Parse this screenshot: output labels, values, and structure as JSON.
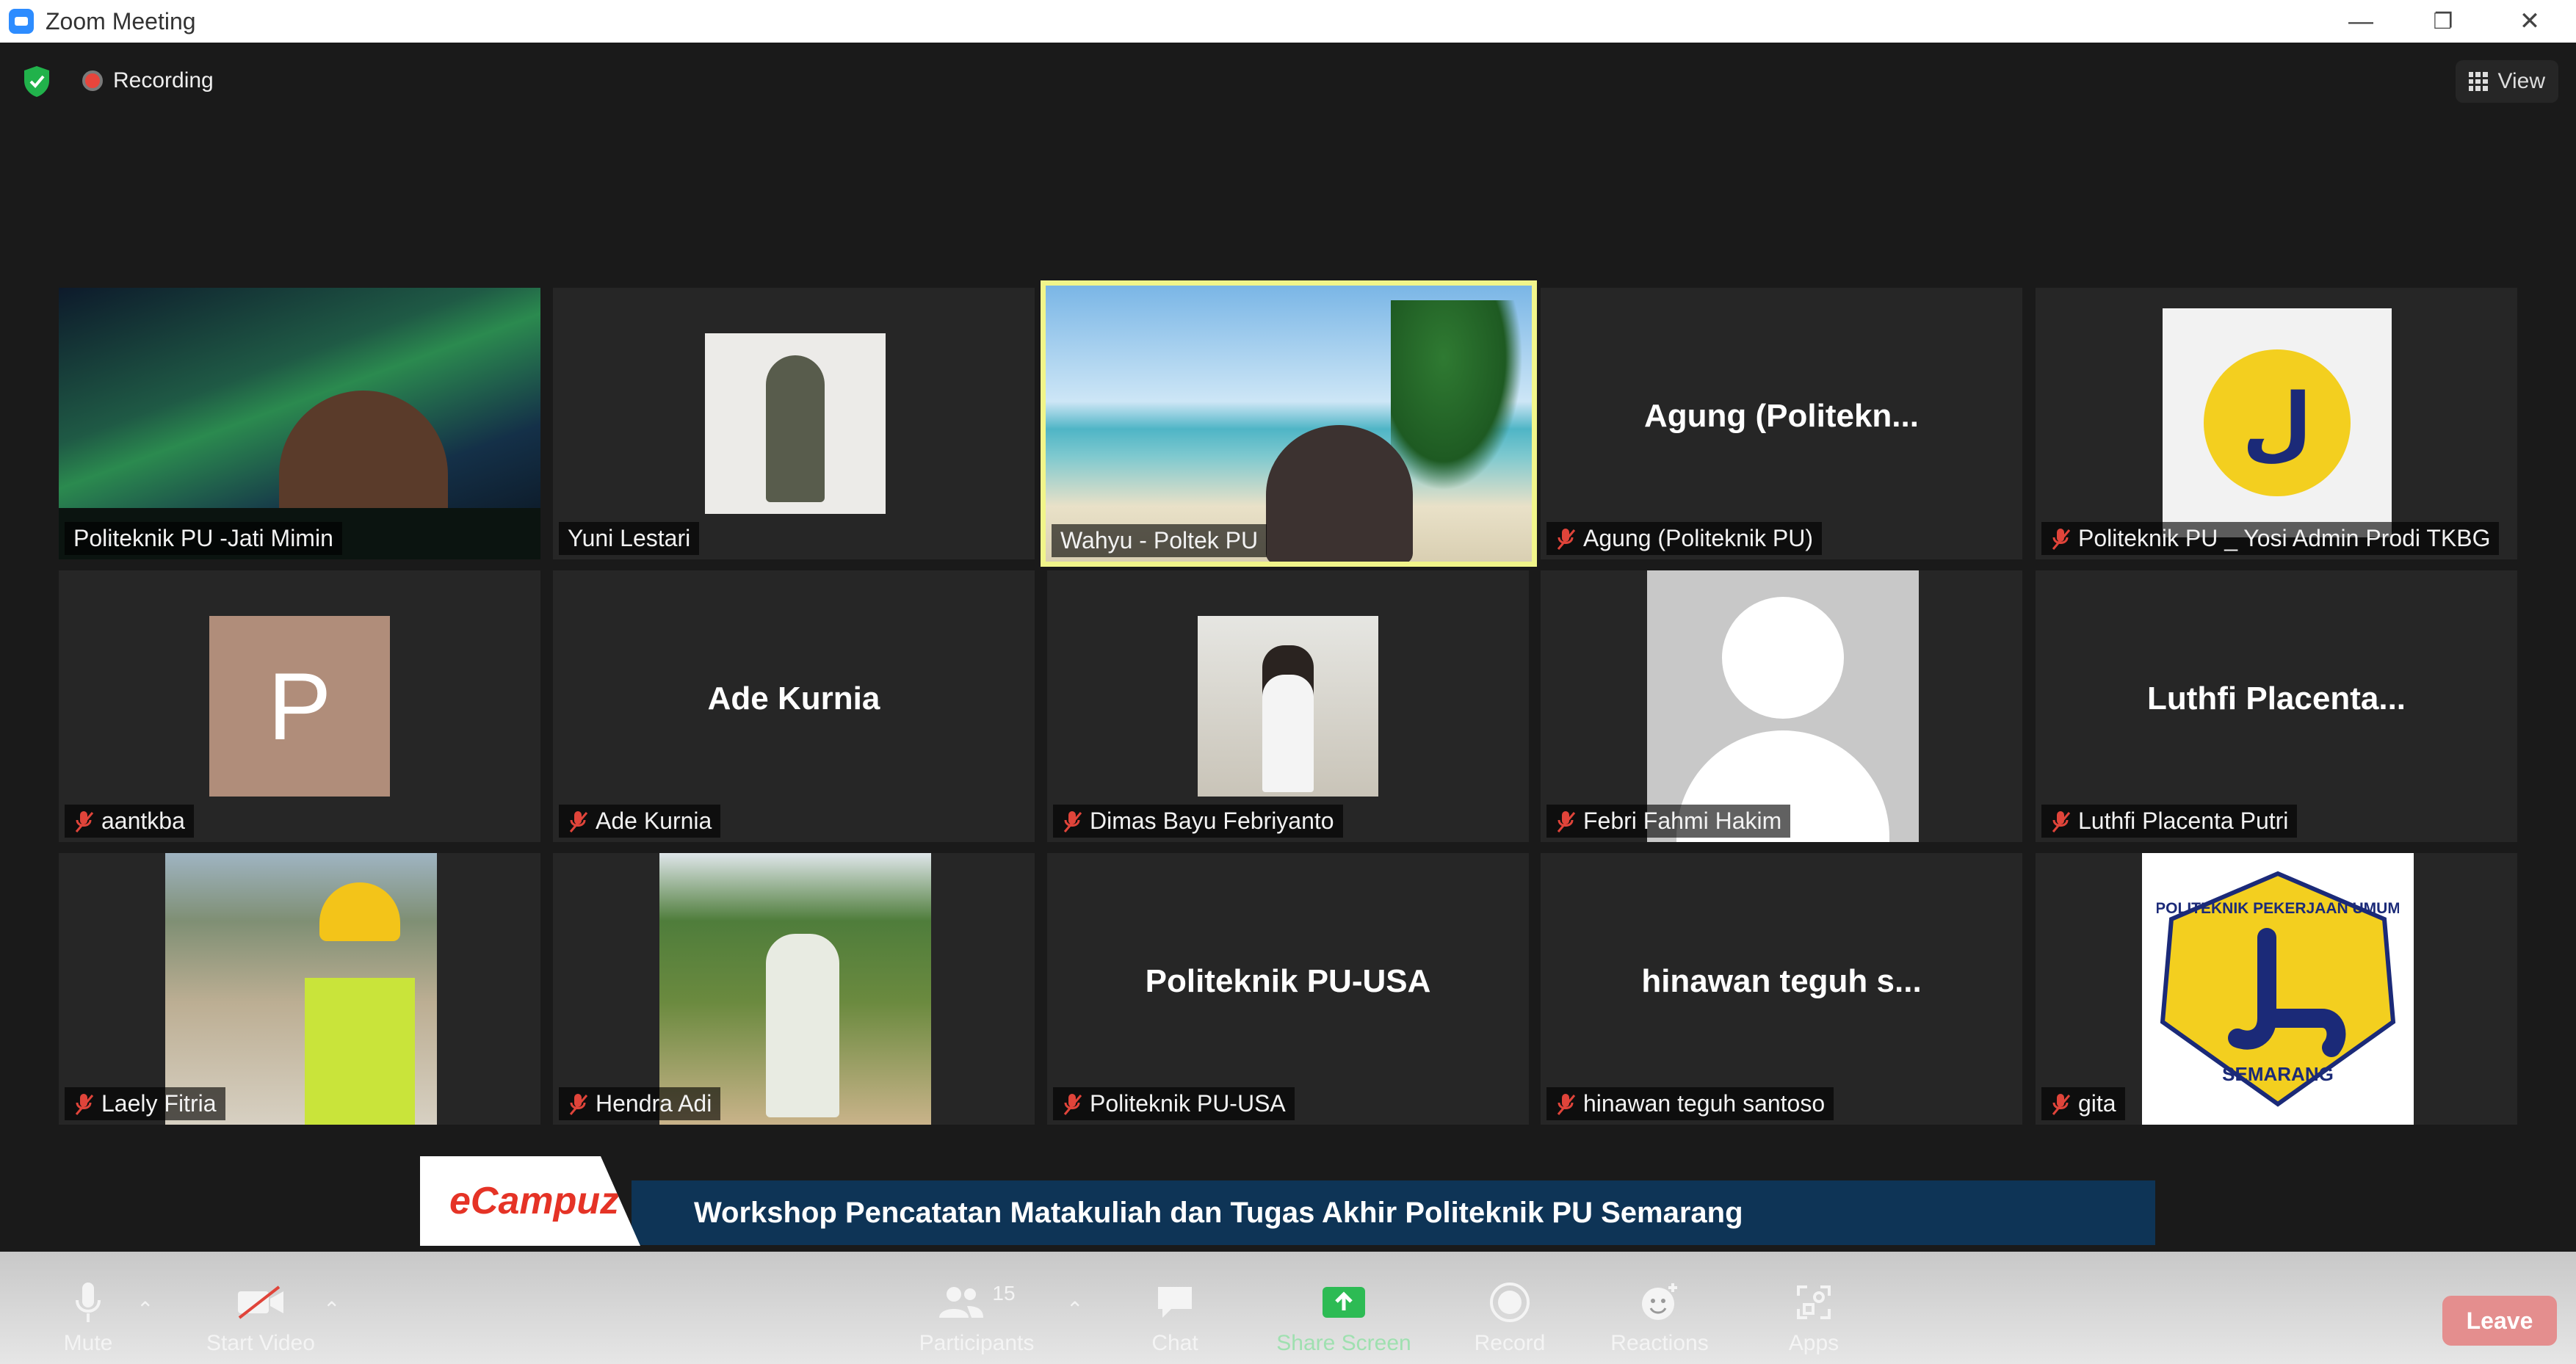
{
  "window": {
    "title": "Zoom Meeting",
    "minimize": "—",
    "restore": "❐",
    "close": "✕"
  },
  "topbar": {
    "recording_label": "Recording",
    "view_label": "View"
  },
  "tiles": [
    {
      "name": "Politeknik PU -Jati Mimin",
      "muted": false
    },
    {
      "name": "Yuni Lestari",
      "muted": false
    },
    {
      "name": "Wahyu - Poltek PU",
      "muted": false,
      "active_speaker": true
    },
    {
      "name": "Agung (Politeknik PU)",
      "display": "Agung  (Politekn...",
      "muted": true
    },
    {
      "name": "Politeknik PU _ Yosi Admin Prodi TKBG",
      "muted": true
    },
    {
      "name": "aantkba",
      "avatar_letter": "P",
      "muted": true
    },
    {
      "name": "Ade Kurnia",
      "display": "Ade Kurnia",
      "muted": true
    },
    {
      "name": "Dimas Bayu Febriyanto",
      "muted": true
    },
    {
      "name": "Febri Fahmi Hakim",
      "muted": true
    },
    {
      "name": "Luthfi Placenta Putri",
      "display": "Luthfi  Placenta...",
      "muted": true
    },
    {
      "name": "Laely Fitria",
      "muted": true
    },
    {
      "name": "Hendra Adi",
      "muted": true
    },
    {
      "name": "Politeknik PU-USA",
      "display": "Politeknik PU-USA",
      "muted": true
    },
    {
      "name": "hinawan teguh santoso",
      "display": "hinawan  teguh  s...",
      "muted": true
    },
    {
      "name": "gita",
      "muted": true
    }
  ],
  "banner": {
    "brand_prefix": "eCampuz",
    "brand_mark": "®",
    "text": "Workshop Pencatatan Matakuliah dan Tugas Akhir Politeknik PU Semarang"
  },
  "toolbar": {
    "mute": "Mute",
    "start_video": "Start Video",
    "participants": "Participants",
    "participants_count": "15",
    "chat": "Chat",
    "share_screen": "Share Screen",
    "record": "Record",
    "reactions": "Reactions",
    "apps": "Apps",
    "leave": "Leave"
  },
  "colors": {
    "share_green": "#2dbb54",
    "active_border": "#f1f58a",
    "banner_navy": "#0e3456",
    "leave_red": "#e48e8e"
  },
  "logo_text": {
    "top": "POLITEKNIK PEKERJAAN UMUM",
    "bottom": "SEMARANG"
  }
}
